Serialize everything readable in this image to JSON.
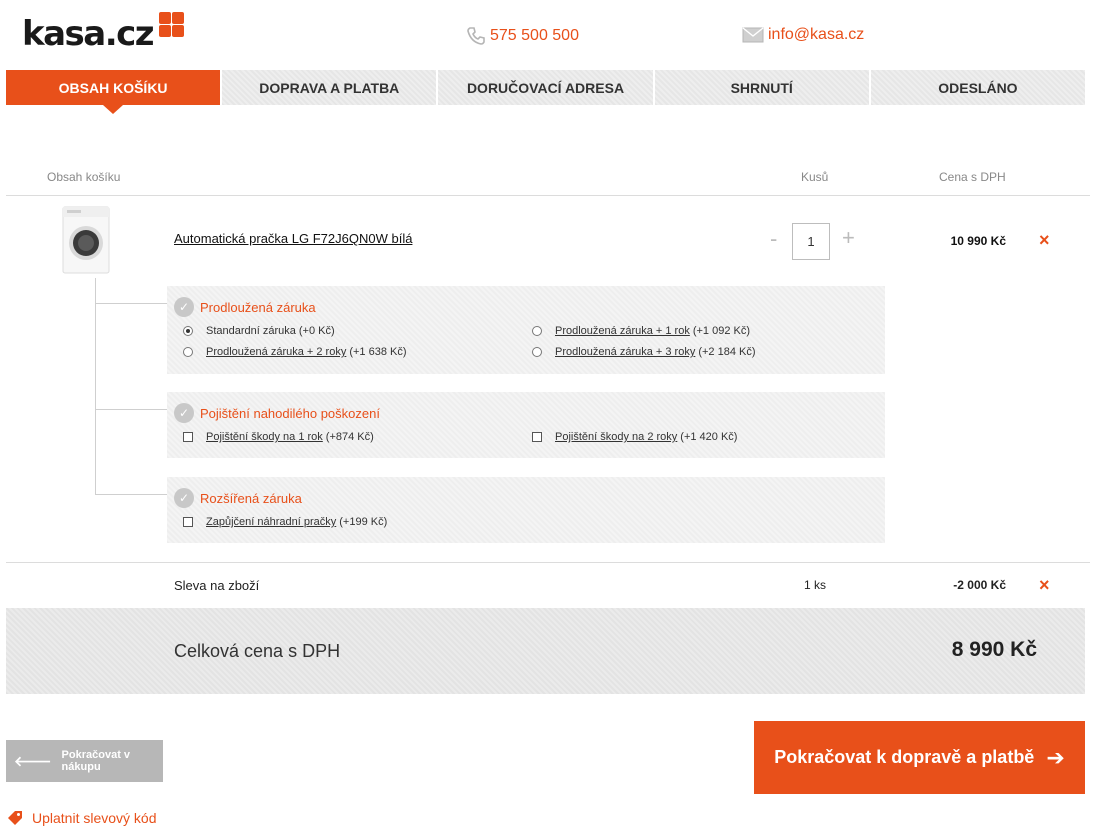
{
  "header": {
    "logo_text": "kasa.cz",
    "phone": "575 500 500",
    "email": "info@kasa.cz"
  },
  "steps": [
    {
      "label": "OBSAH KOŠÍKU",
      "active": true
    },
    {
      "label": "DOPRAVA A PLATBA",
      "active": false
    },
    {
      "label": "DORUČOVACÍ ADRESA",
      "active": false
    },
    {
      "label": "SHRNUTÍ",
      "active": false
    },
    {
      "label": "ODESLÁNO",
      "active": false
    }
  ],
  "table_header": {
    "content": "Obsah košíku",
    "qty": "Kusů",
    "price": "Cena s DPH"
  },
  "product": {
    "name": "Automatická pračka LG F72J6QN0W bílá",
    "qty_minus": "-",
    "qty": "1",
    "qty_plus": "+",
    "price": "10 990 Kč",
    "remove": "×"
  },
  "services": [
    {
      "title": "Prodloužená záruka",
      "options": [
        {
          "link": "",
          "plain": "Standardní záruka",
          "extra": "(+0 Kč)",
          "type": "radio",
          "selected": true
        },
        {
          "link": "Prodloužená záruka + 1 rok",
          "plain": "",
          "extra": "(+1 092 Kč)",
          "type": "radio",
          "selected": false
        },
        {
          "link": "Prodloužená záruka + 2 roky",
          "plain": "",
          "extra": "(+1 638 Kč)",
          "type": "radio",
          "selected": false
        },
        {
          "link": "Prodloužená záruka + 3 roky",
          "plain": "",
          "extra": "(+2 184 Kč)",
          "type": "radio",
          "selected": false
        }
      ]
    },
    {
      "title": "Pojištění nahodilého poškození",
      "options": [
        {
          "link": "Pojištění škody na 1 rok",
          "plain": "",
          "extra": "(+874 Kč)",
          "type": "checkbox",
          "selected": false
        },
        {
          "link": "Pojištění škody na 2 roky",
          "plain": "",
          "extra": "(+1 420 Kč)",
          "type": "checkbox",
          "selected": false
        }
      ]
    },
    {
      "title": "Rozšířená záruka",
      "options": [
        {
          "link": "Zapůjčení náhradní pračky",
          "plain": "",
          "extra": "(+199 Kč)",
          "type": "checkbox",
          "selected": false
        }
      ]
    }
  ],
  "discount": {
    "label": "Sleva na zboží",
    "qty": "1 ks",
    "price": "-2 000 Kč",
    "remove": "×"
  },
  "total": {
    "label": "Celková cena s DPH",
    "price": "8 990 Kč"
  },
  "buttons": {
    "back": "Pokračovat v nákupu",
    "next": "Pokračovat k dopravě a platbě",
    "coupon": "Uplatnit slevový kód"
  },
  "colors": {
    "accent": "#e8501a",
    "back_button": "#b7b7b7"
  },
  "icons": {
    "phone": "phone-icon",
    "email": "mail-icon",
    "remove": "close-icon",
    "service": "gear-icon",
    "back": "arrow-left-icon",
    "next": "arrow-right-icon",
    "coupon": "tag-icon"
  }
}
